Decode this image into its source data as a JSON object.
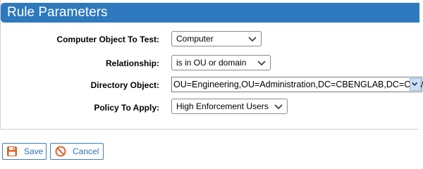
{
  "panel": {
    "title": "Rule Parameters"
  },
  "form": {
    "fields": [
      {
        "label": "Computer Object To Test:",
        "value": "Computer"
      },
      {
        "label": "Relationship:",
        "value": "is in OU or domain"
      },
      {
        "label": "Directory Object:",
        "value": "OU=Engineering,OU=Administration,DC=CBENGLAB,DC=COM"
      },
      {
        "label": "Policy To Apply:",
        "value": "High Enforcement Users"
      }
    ]
  },
  "actions": {
    "save_label": "Save",
    "cancel_label": "Cancel"
  },
  "icons": {
    "save": "floppy-disk-icon",
    "cancel": "no-entry-icon",
    "dropdown": "chevron-down-icon"
  },
  "colors": {
    "header_bg": "#2e79be",
    "header_text": "#ffffff",
    "button_border": "#3f7fbf",
    "button_text": "#2f6fb5",
    "save_icon": "#e0622a",
    "cancel_icon": "#e0622a"
  }
}
